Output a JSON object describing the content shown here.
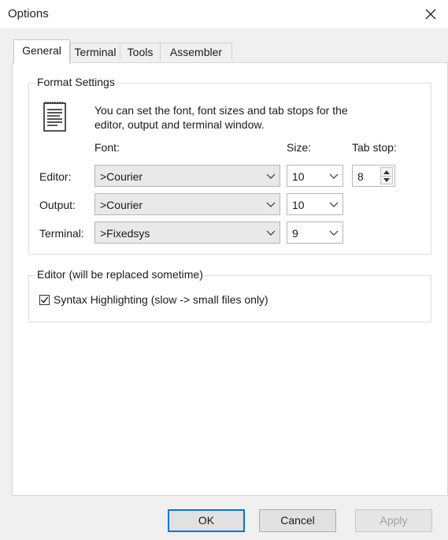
{
  "window": {
    "title": "Options"
  },
  "tabs": [
    {
      "label": "General",
      "active": true
    },
    {
      "label": "Terminal",
      "active": false
    },
    {
      "label": "Tools",
      "active": false
    },
    {
      "label": "Assembler",
      "active": false
    }
  ],
  "format_settings": {
    "group_label": "Format Settings",
    "description_line1": "You can set the font, font sizes and tab stops for the",
    "description_line2": "editor, output and terminal window.",
    "icon": "document-icon",
    "headers": {
      "font": "Font:",
      "size": "Size:",
      "tab_stop": "Tab stop:"
    },
    "rows": [
      {
        "label": "Editor:",
        "font": ">Courier",
        "size": "10",
        "tab_stop": "8"
      },
      {
        "label": "Output:",
        "font": ">Courier",
        "size": "10"
      },
      {
        "label": "Terminal:",
        "font": ">Fixedsys",
        "size": "9"
      }
    ]
  },
  "editor_group": {
    "group_label": "Editor (will be replaced sometime)",
    "syntax_highlighting": {
      "label": "Syntax Highlighting (slow -> small files only)",
      "checked": true
    }
  },
  "buttons": {
    "ok": "OK",
    "cancel": "Cancel",
    "apply": "Apply"
  },
  "colors": {
    "accent": "#0078d7",
    "panel": "#ffffff",
    "background": "#f0f0f0"
  }
}
